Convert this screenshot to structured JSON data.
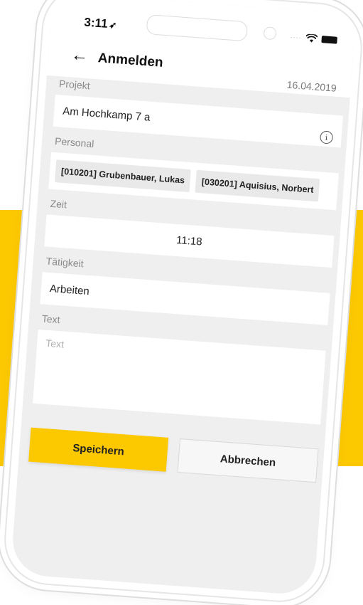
{
  "status": {
    "time": "3:11",
    "location_glyph": "➶"
  },
  "header": {
    "back_glyph": "←",
    "title": "Anmelden",
    "date": "16.04.2019"
  },
  "form": {
    "projekt": {
      "label": "Projekt",
      "value": "Am Hochkamp 7 a",
      "info_glyph": "i"
    },
    "personal": {
      "label": "Personal",
      "chips": [
        "[010201] Grubenbauer, Lukas",
        "[030201] Aquisius, Norbert"
      ]
    },
    "zeit": {
      "label": "Zeit",
      "value": "11:18"
    },
    "taetigkeit": {
      "label": "Tätigkeit",
      "value": "Arbeiten"
    },
    "text": {
      "label": "Text",
      "placeholder": "Text"
    }
  },
  "buttons": {
    "save": "Speichern",
    "cancel": "Abbrechen"
  },
  "colors": {
    "accent": "#fcc800",
    "screen_bg": "#efefef"
  }
}
